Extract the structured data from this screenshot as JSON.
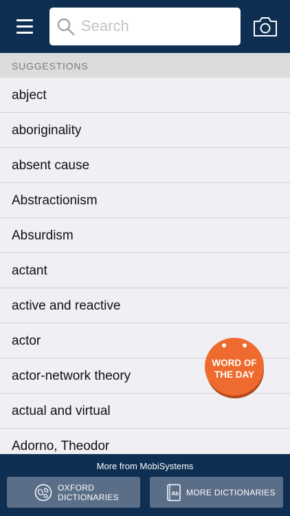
{
  "header": {
    "search_placeholder": "Search"
  },
  "suggestions": {
    "title": "SUGGESTIONS",
    "items": [
      "abject",
      "aboriginality",
      "absent cause",
      "Abstractionism",
      "Absurdism",
      "actant",
      "active and reactive",
      "actor",
      "actor-network theory",
      "actual and virtual",
      "Adorno, Theodor"
    ]
  },
  "word_of_day": {
    "line1": "WORD OF",
    "line2": "THE DAY",
    "color": "#ee6a2e"
  },
  "footer": {
    "title": "More from MobiSystems",
    "oxford_line1": "OXFORD",
    "oxford_line2": "DICTIONARIES",
    "more_label": "MORE DICTIONARIES"
  },
  "colors": {
    "navy": "#0e2e52",
    "footer_button": "#5b6e88"
  }
}
